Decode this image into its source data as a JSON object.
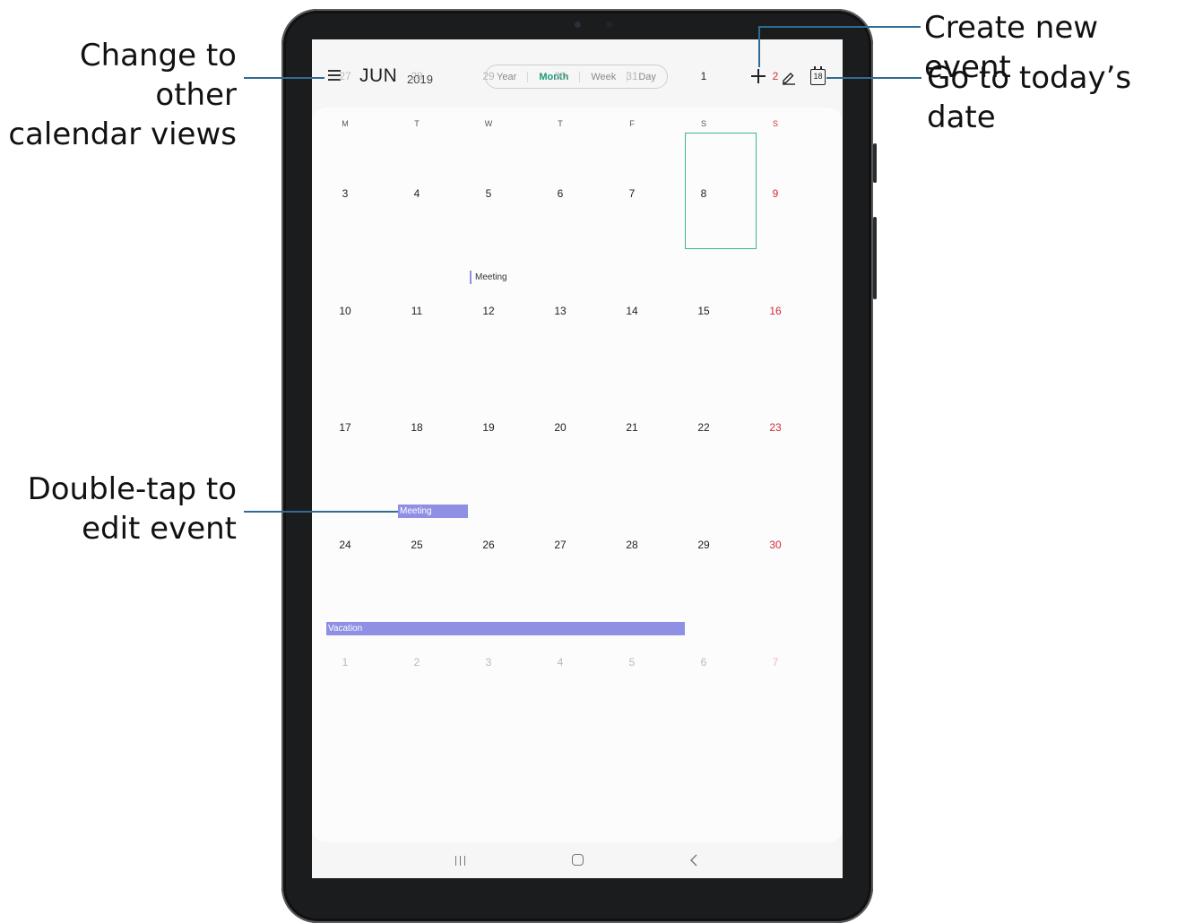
{
  "callouts": {
    "views_line1": "Change to other",
    "views_line2": "calendar views",
    "create": "Create new event",
    "today": "Go to today’s date",
    "edit_line1": "Double-tap to",
    "edit_line2": "edit event"
  },
  "header": {
    "month": "JUN",
    "year": "2019",
    "views": [
      "Year",
      "Month",
      "Week",
      "Day"
    ],
    "active_view": "Month",
    "today_icon_number": "18"
  },
  "weekdays": [
    "M",
    "T",
    "W",
    "T",
    "F",
    "S",
    "S"
  ],
  "weeks": [
    [
      "27",
      "28",
      "29",
      "30",
      "31",
      "1",
      "2"
    ],
    [
      "3",
      "4",
      "5",
      "6",
      "7",
      "8",
      "9"
    ],
    [
      "10",
      "11",
      "12",
      "13",
      "14",
      "15",
      "16"
    ],
    [
      "17",
      "18",
      "19",
      "20",
      "21",
      "22",
      "23"
    ],
    [
      "24",
      "25",
      "26",
      "27",
      "28",
      "29",
      "30"
    ],
    [
      "1",
      "2",
      "3",
      "4",
      "5",
      "6",
      "7"
    ]
  ],
  "events": {
    "meeting_5": "Meeting",
    "meeting_18": "Meeting",
    "vacation": "Vacation"
  },
  "colors": {
    "accent": "#1f9a79",
    "sunday": "#d12c3a",
    "event": "#8f90e4",
    "callout_line": "#2f6c94"
  }
}
